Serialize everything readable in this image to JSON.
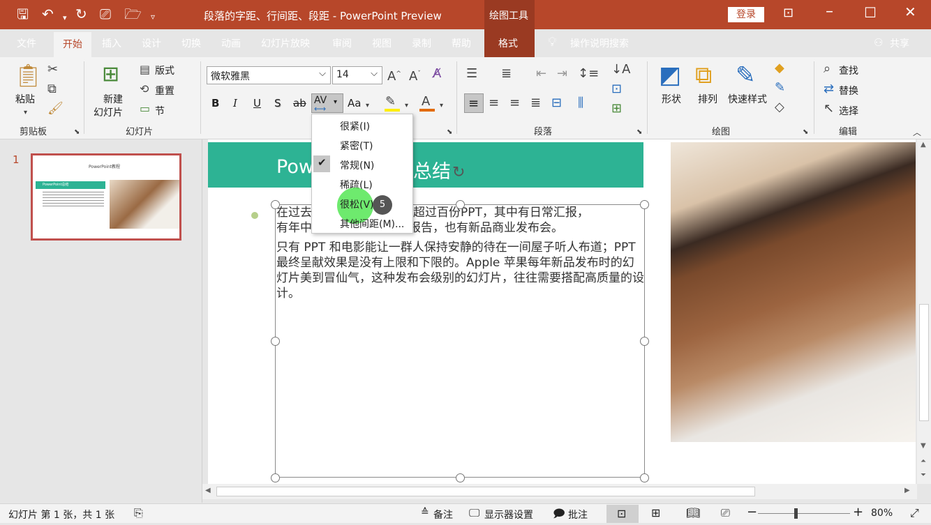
{
  "title": {
    "doc": "段落的字距、行间距、段距",
    "sep": "-",
    "app": "PowerPoint Preview",
    "context_tab": "绘图工具",
    "login": "登录"
  },
  "tabs": {
    "file": "文件",
    "home": "开始",
    "insert": "插入",
    "design": "设计",
    "transitions": "切换",
    "animations": "动画",
    "slideshow": "幻灯片放映",
    "review": "审阅",
    "view": "视图",
    "record": "录制",
    "help": "帮助",
    "format": "格式",
    "tellme": "操作说明搜索",
    "share": "共享"
  },
  "ribbon": {
    "paste": "粘贴",
    "clipboard": "剪贴板",
    "new_slide_1": "新建",
    "new_slide_2": "幻灯片",
    "layout": "版式",
    "reset": "重置",
    "section": "节",
    "slides": "幻灯片",
    "font_name": "微软雅黑",
    "font_size": "14",
    "bold": "B",
    "italic": "I",
    "underline": "U",
    "shadow": "S",
    "strike": "ab",
    "spacing": "AV",
    "case": "Aa",
    "paragraph": "段落",
    "shape": "形状",
    "arrange": "排列",
    "quick_styles": "快速样式",
    "drawing": "绘图",
    "find": "查找",
    "replace": "替换",
    "select": "选择",
    "editing": "编辑"
  },
  "menu": {
    "items": [
      "很紧(I)",
      "紧密(T)",
      "常规(N)",
      "稀疏(L)",
      "很松(V)",
      "其他间距(M)..."
    ],
    "badge": "5"
  },
  "slide": {
    "number": "1",
    "title_left": "Pow",
    "title_right": "总结",
    "para1_line1": "在过去",
    "para1_rest": "我做了超过百份PPT，其中有日常汇报，",
    "para1_line2a": "有年中",
    "para1_line2b": "机构的报告，也有新品商业发布会。",
    "para2": "只有 PPT 和电影能让一群人保持安静的待在一间屋子听人布道；PPT 最终呈献效果是没有上限和下限的。Apple 苹果每年新品发布时的幻灯片美到冒仙气，这种发布会级别的幻灯片，往往需要搭配高质量的设计。",
    "thumb_title": "PowerPoint教程",
    "thumb_sub": "PowerPoint总结"
  },
  "status": {
    "slide_info": "幻灯片 第 1 张，共 1 张",
    "notes": "备注",
    "display": "显示器设置",
    "comments": "批注",
    "zoom": "80%"
  },
  "colors": {
    "accent": "#b7472a",
    "teal": "#2db394",
    "highlight": "#55e655"
  }
}
